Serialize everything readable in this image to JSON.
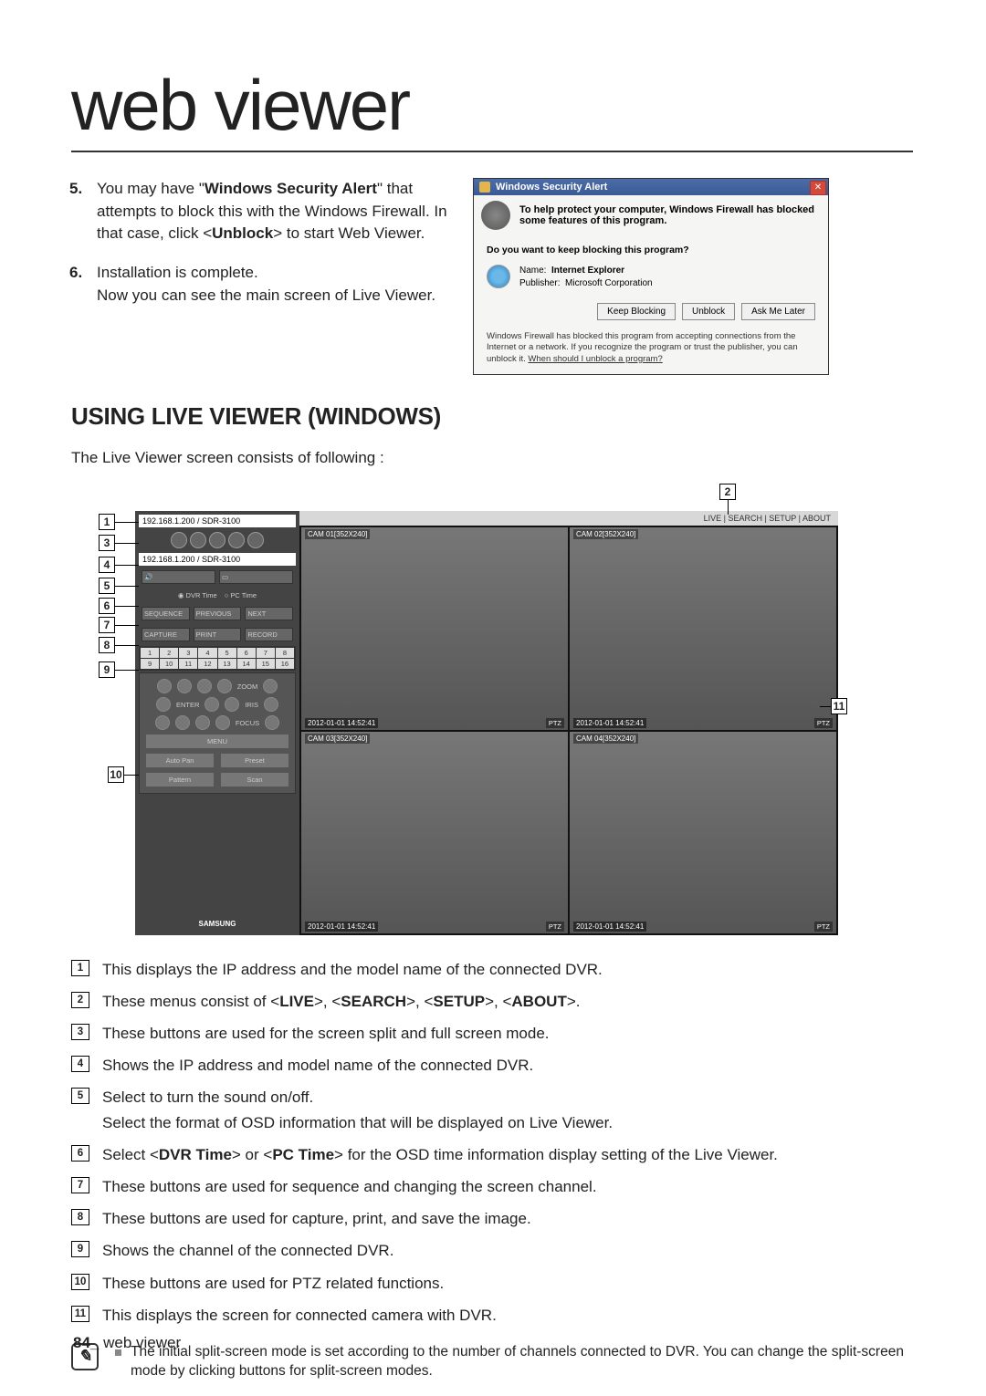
{
  "chapter_title": "web viewer",
  "steps": [
    {
      "num": "5.",
      "text_a": "You may have \"",
      "text_bold1": "Windows Security Alert",
      "text_b": "\" that attempts to block this with the Windows Firewall. In that case, click <",
      "text_bold2": "Unblock",
      "text_c": "> to start Web Viewer."
    },
    {
      "num": "6.",
      "line1": "Installation is complete.",
      "line2": "Now you can see the main screen of Live Viewer."
    }
  ],
  "dialog": {
    "title": "Windows Security Alert",
    "banner": "To help protect your computer, Windows Firewall has blocked some features of this program.",
    "question": "Do you want to keep blocking this program?",
    "name_label": "Name:",
    "name_value": "Internet Explorer",
    "pub_label": "Publisher:",
    "pub_value": "Microsoft Corporation",
    "btn_keep": "Keep Blocking",
    "btn_unblock": "Unblock",
    "btn_ask": "Ask Me Later",
    "footer_a": "Windows Firewall has blocked this program from accepting connections from the Internet or a network. If you recognize the program or trust the publisher, you can unblock it. ",
    "footer_link": "When should I unblock a program?"
  },
  "section_heading": "USING LIVE VIEWER (WINDOWS)",
  "intro_line": "The Live Viewer screen consists of following :",
  "live_viewer": {
    "ip_bar": "192.168.1.200 / SDR-3100",
    "ip_bar2": "192.168.1.200   / SDR-3100",
    "menu": "LIVE  |  SEARCH  |  SETUP  | ABOUT",
    "radio1": "DVR Time",
    "radio2": "PC Time",
    "btn_seq": "SEQUENCE",
    "btn_prev": "PREVIOUS",
    "btn_next": "NEXT",
    "btn_cap": "CAPTURE",
    "btn_print": "PRINT",
    "btn_rec": "RECORD",
    "channels": [
      "1",
      "2",
      "3",
      "4",
      "5",
      "6",
      "7",
      "8",
      "9",
      "10",
      "11",
      "12",
      "13",
      "14",
      "15",
      "16"
    ],
    "ptz_zoom": "ZOOM",
    "ptz_iris": "IRIS",
    "ptz_focus": "FOCUS",
    "ptz_enter": "ENTER",
    "ptz_menu": "MENU",
    "ptz_auto": "Auto Pan",
    "ptz_preset": "Preset",
    "ptz_pattern": "Pattern",
    "ptz_scan": "Scan",
    "brand": "SAMSUNG",
    "cams": [
      {
        "label": "CAM 01[352X240]",
        "time": "2012-01-01 14:52:41",
        "ptz": "PTZ"
      },
      {
        "label": "CAM 02[352X240]",
        "time": "2012-01-01 14:52:41",
        "ptz": "PTZ"
      },
      {
        "label": "CAM 03[352X240]",
        "time": "2012-01-01 14:52:41",
        "ptz": "PTZ"
      },
      {
        "label": "CAM 04[352X240]",
        "time": "2012-01-01 14:52:41",
        "ptz": "PTZ"
      }
    ]
  },
  "callouts": {
    "c1": "1",
    "c2": "2",
    "c3": "3",
    "c4": "4",
    "c5": "5",
    "c6": "6",
    "c7": "7",
    "c8": "8",
    "c9": "9",
    "c10": "10",
    "c11": "11"
  },
  "descriptions": [
    {
      "n": "1",
      "text_a": "This displays the IP address and the model name of the connected DVR."
    },
    {
      "n": "2",
      "text_a": "These menus consist of <",
      "b1": "LIVE",
      "t2": ">, <",
      "b2": "SEARCH",
      "t3": ">, <",
      "b3": "SETUP",
      "t4": ">, <",
      "b4": "ABOUT",
      "t5": ">."
    },
    {
      "n": "3",
      "text_a": "These buttons are used for the screen split and full screen mode."
    },
    {
      "n": "4",
      "text_a": "Shows the IP address and model name of the connected DVR."
    },
    {
      "n": "5",
      "text_a": "Select to turn the sound on/off.",
      "line2": "Select the format of OSD information that will be displayed on Live Viewer."
    },
    {
      "n": "6",
      "text_a": "Select <",
      "b1": "DVR Time",
      "t2": "> or <",
      "b2": "PC Time",
      "t3": "> for the OSD time information display setting of the Live Viewer."
    },
    {
      "n": "7",
      "text_a": "These buttons are used for sequence and changing the screen channel."
    },
    {
      "n": "8",
      "text_a": "These buttons are used for capture, print, and save the image."
    },
    {
      "n": "9",
      "text_a": "Shows the channel of the connected DVR."
    },
    {
      "n": "10",
      "text_a": "These buttons are used for PTZ related functions."
    },
    {
      "n": "11",
      "text_a": "This displays the screen for connected camera with DVR."
    }
  ],
  "note": "The initial split-screen mode is set according to the number of channels connected to DVR. You can change the split-screen mode by clicking buttons for split-screen modes.",
  "footer_num": "84_",
  "footer_label": " web viewer"
}
